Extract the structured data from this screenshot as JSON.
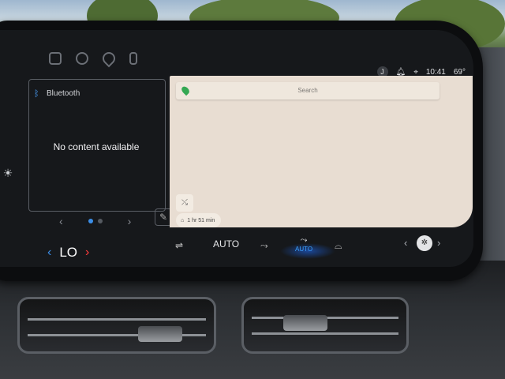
{
  "status": {
    "user_initial": "J",
    "time": "10:41",
    "temperature": "69°"
  },
  "top_icons": [
    "grid-icon",
    "toggle-icon",
    "location-pin-icon",
    "phone-icon"
  ],
  "bluetooth_panel": {
    "title": "Bluetooth",
    "empty_message": "No content available"
  },
  "map": {
    "search_placeholder": "Search",
    "eta": "1 hr 51 min"
  },
  "climate": {
    "driver_temp": "LO",
    "fan_mode": "AUTO",
    "airflow_mode_sub": "AUTO"
  },
  "colors": {
    "accent_blue": "#3b8ee8",
    "heat_red": "#ff3b3b",
    "map_bg": "#e8ddd2"
  }
}
